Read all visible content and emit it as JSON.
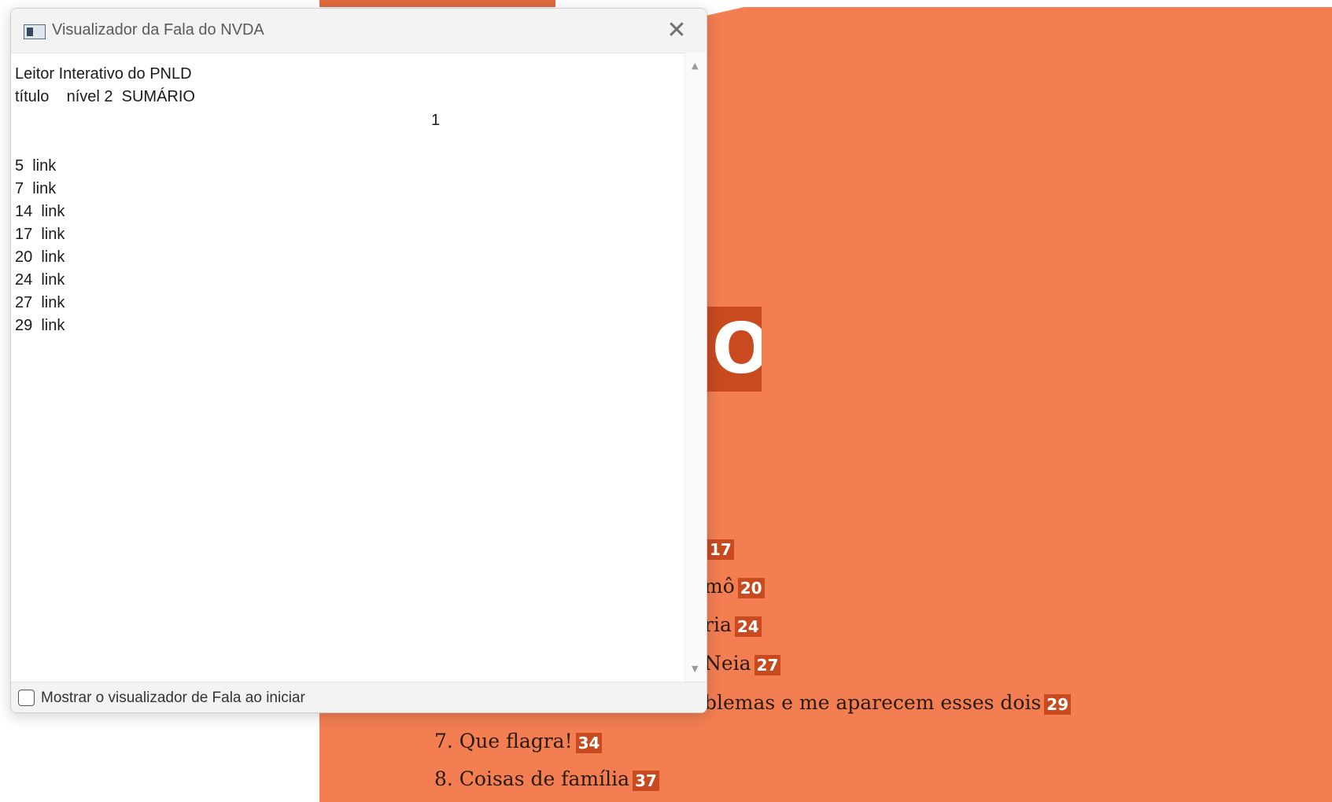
{
  "nvda_window": {
    "title": "Visualizador da Fala do NVDA",
    "close_glyph": "✕",
    "speech_lines": [
      "Leitor Interativo do PNLD",
      "título    nível 2  SUMÁRIO",
      "1",
      "5  link",
      "7  link",
      "14  link",
      "17  link",
      "20  link",
      "24  link",
      "27  link",
      "29  link"
    ],
    "show_on_start_label": "Mostrar o visualizador de Fala ao iniciar",
    "show_on_start_checked": false
  },
  "book_page": {
    "heading_fragment": "IO",
    "toc": [
      {
        "text": "",
        "page": "17"
      },
      {
        "text": "mô",
        "page": "20"
      },
      {
        "text": "ria",
        "page": "24"
      },
      {
        "text": "Neia",
        "page": "27"
      },
      {
        "text": "blemas e me aparecem esses dois",
        "page": "29"
      },
      {
        "text": "7. Que flagra!",
        "page": "34"
      },
      {
        "text": "8. Coisas de família",
        "page": "37"
      }
    ]
  },
  "colors": {
    "page_orange": "#f27e52",
    "accent_red": "#c94a1f"
  }
}
